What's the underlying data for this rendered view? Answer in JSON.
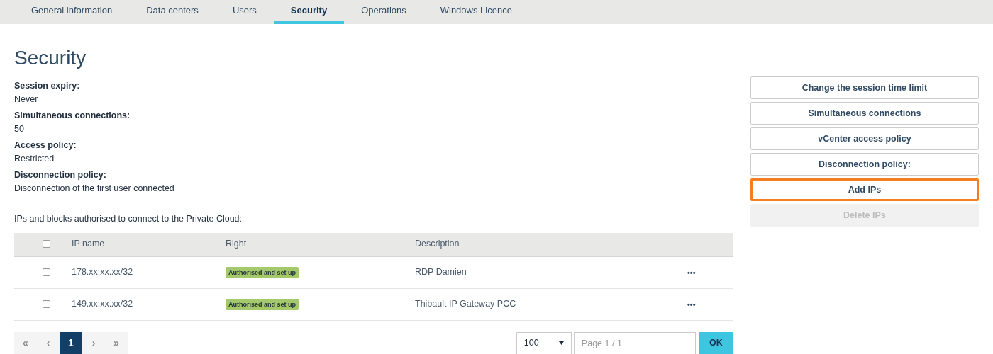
{
  "tabs": [
    {
      "label": "General information",
      "selected": false
    },
    {
      "label": "Data centers",
      "selected": false
    },
    {
      "label": "Users",
      "selected": false
    },
    {
      "label": "Security",
      "selected": true
    },
    {
      "label": "Operations",
      "selected": false
    },
    {
      "label": "Windows Licence",
      "selected": false
    }
  ],
  "title": "Security",
  "properties": [
    {
      "label": "Session expiry:",
      "value": "Never"
    },
    {
      "label": "Simultaneous connections:",
      "value": "50"
    },
    {
      "label": "Access policy:",
      "value": "Restricted"
    },
    {
      "label": "Disconnection policy:",
      "value": "Disconnection of the first user connected"
    }
  ],
  "table_caption": "IPs and blocks authorised to connect to the Private Cloud:",
  "table": {
    "select_all_checked": false,
    "columns": [
      "IP name",
      "Right",
      "Description"
    ],
    "rows": [
      {
        "checked": false,
        "ip_name": "178.xx.xx.xx/32",
        "right": "Authorised and set up",
        "description": "RDP Damien",
        "menu": "•••"
      },
      {
        "checked": false,
        "ip_name": "149.xx.xx.xx/32",
        "right": "Authorised and set up",
        "description": "Thibault IP Gateway PCC",
        "menu": "•••"
      }
    ]
  },
  "pagination": {
    "buttons": [
      {
        "label": "«",
        "disabled": true,
        "selected": false
      },
      {
        "label": "‹",
        "disabled": true,
        "selected": false
      },
      {
        "label": "1",
        "disabled": false,
        "selected": true
      },
      {
        "label": "›",
        "disabled": true,
        "selected": false
      },
      {
        "label": "»",
        "disabled": true,
        "selected": false
      }
    ],
    "page_size": "100",
    "page_placeholder": "Page 1 / 1",
    "ok": "OK"
  },
  "actions": [
    {
      "label": "Change the session time limit",
      "disabled": false,
      "highlighted": false
    },
    {
      "label": "Simultaneous connections",
      "disabled": false,
      "highlighted": false
    },
    {
      "label": "vCenter access policy",
      "disabled": false,
      "highlighted": false
    },
    {
      "label": "Disconnection policy:",
      "disabled": false,
      "highlighted": false
    },
    {
      "label": "Add IPs",
      "disabled": false,
      "highlighted": true
    },
    {
      "label": "Delete IPs",
      "disabled": true,
      "highlighted": false
    }
  ]
}
